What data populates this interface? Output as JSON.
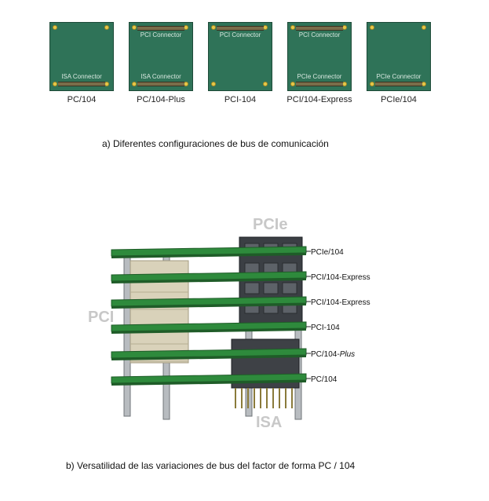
{
  "boards": [
    {
      "name": "PC/104",
      "connectors": [
        "ISA Connector"
      ],
      "color": "#2f7358"
    },
    {
      "name": "PC/104-Plus",
      "connectors": [
        "PCI Connector",
        "ISA Connector"
      ],
      "color": "#2f7358"
    },
    {
      "name": "PCI-104",
      "connectors": [
        "PCI Connector"
      ],
      "color": "#2f7358"
    },
    {
      "name": "PCI/104-Express",
      "connectors": [
        "PCI Connector",
        "PCIe Connector"
      ],
      "color": "#2f7358"
    },
    {
      "name": "PCIe/104",
      "connectors": [
        "PCIe Connector"
      ],
      "color": "#2f7358"
    }
  ],
  "caption_a": "a) Diferentes configuraciones de bus de comunicación",
  "stack": {
    "big_labels": {
      "pcie": "PCIe",
      "pci": "PCI",
      "isa": "ISA"
    },
    "layers": [
      {
        "name": "PCIe/104",
        "italic_suffix": ""
      },
      {
        "name": "PCI/104-Express",
        "italic_suffix": ""
      },
      {
        "name": "PCI/104-Express",
        "italic_suffix": ""
      },
      {
        "name": "PCI-104",
        "italic_suffix": ""
      },
      {
        "name": "PC/104-",
        "italic_suffix": "Plus"
      },
      {
        "name": "PC/104",
        "italic_suffix": ""
      }
    ]
  },
  "caption_b": "b) Versatilidad de las variaciones de bus del factor de forma PC / 104",
  "colors": {
    "pcb": "#2f7358",
    "pcb_layer": "#2e8a3c",
    "label_gray": "#c8c8c8",
    "connector_beige": "#d9d2ba"
  }
}
